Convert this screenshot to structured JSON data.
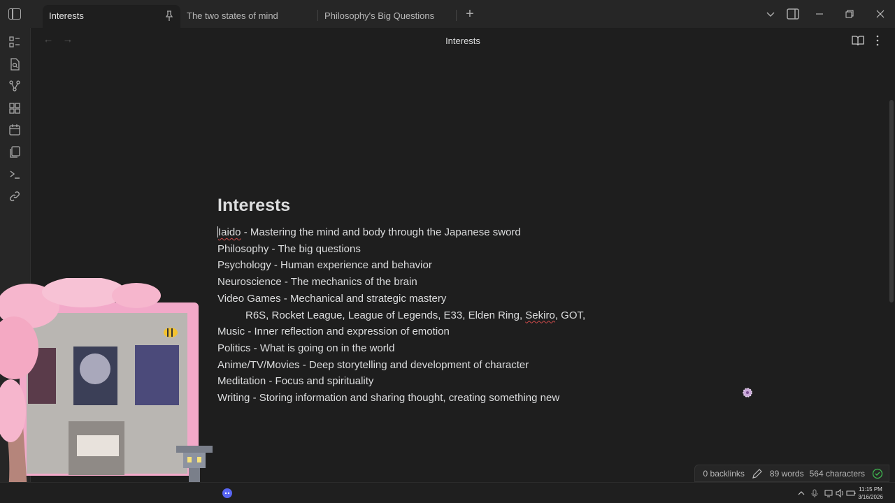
{
  "tabs": [
    {
      "label": "Interests",
      "active": true,
      "pinned": true
    },
    {
      "label": "The two states of mind",
      "active": false
    },
    {
      "label": "Philosophy's Big Questions",
      "active": false
    }
  ],
  "view": {
    "title": "Interests"
  },
  "note": {
    "title": "Interests",
    "lines": [
      {
        "misspelled": "Iaido",
        "rest": " - Mastering the mind and body through the Japanese sword"
      },
      {
        "text": "Philosophy - The big questions"
      },
      {
        "text": "Psychology - Human experience and behavior"
      },
      {
        "text": "Neuroscience - The mechanics of the brain"
      },
      {
        "text": "Video Games - Mechanical and strategic mastery"
      },
      {
        "indent_pre": "R6S, Rocket League, League of Legends, E33, Elden Ring, ",
        "misspelled": "Sekiro",
        "indent_post": ", GOT,"
      },
      {
        "text": "Music - Inner reflection and expression of emotion"
      },
      {
        "text": "Politics - What is going on in the world"
      },
      {
        "text": "Anime/TV/Movies - Deep storytelling and development of character"
      },
      {
        "text": "Meditation - Focus and spirituality"
      },
      {
        "text": "Writing - Storing information and sharing thought, creating something new"
      }
    ]
  },
  "status": {
    "backlinks": "0 backlinks",
    "words": "89 words",
    "characters": "564 characters"
  },
  "taskbar": {
    "time": "11:15 PM",
    "date": "3/16/2026"
  },
  "icons": {
    "ribbon": [
      "file-tree-icon",
      "search-file-icon",
      "graph-icon",
      "canvas-icon",
      "calendar-icon",
      "templates-icon",
      "command-icon",
      "link-icon"
    ]
  },
  "colors": {
    "background": "#1e1e1e",
    "chrome": "#262626",
    "text": "#dcddde",
    "accent_check": "#3fb950"
  }
}
